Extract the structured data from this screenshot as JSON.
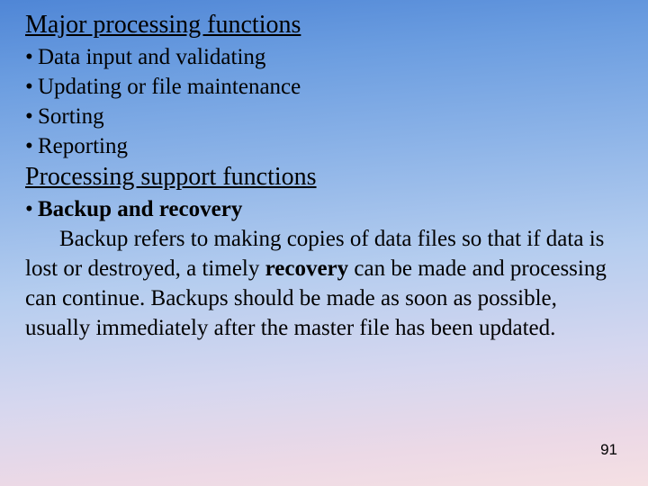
{
  "heading1": "Major processing functions",
  "bullets1": [
    "Data input and validating",
    "Updating or file maintenance",
    "Sorting",
    "Reporting"
  ],
  "heading2": "Processing support functions",
  "sub_bullet_bold": "Backup and recovery",
  "para_parts": {
    "p1": "Backup refers to making copies of data files so that if data is lost or destroyed, a timely ",
    "p2_bold": "recovery",
    "p3": " can be made and processing can continue. Backups should be made as soon as possible, usually immediately after the master file has been updated."
  },
  "page_number": "91"
}
